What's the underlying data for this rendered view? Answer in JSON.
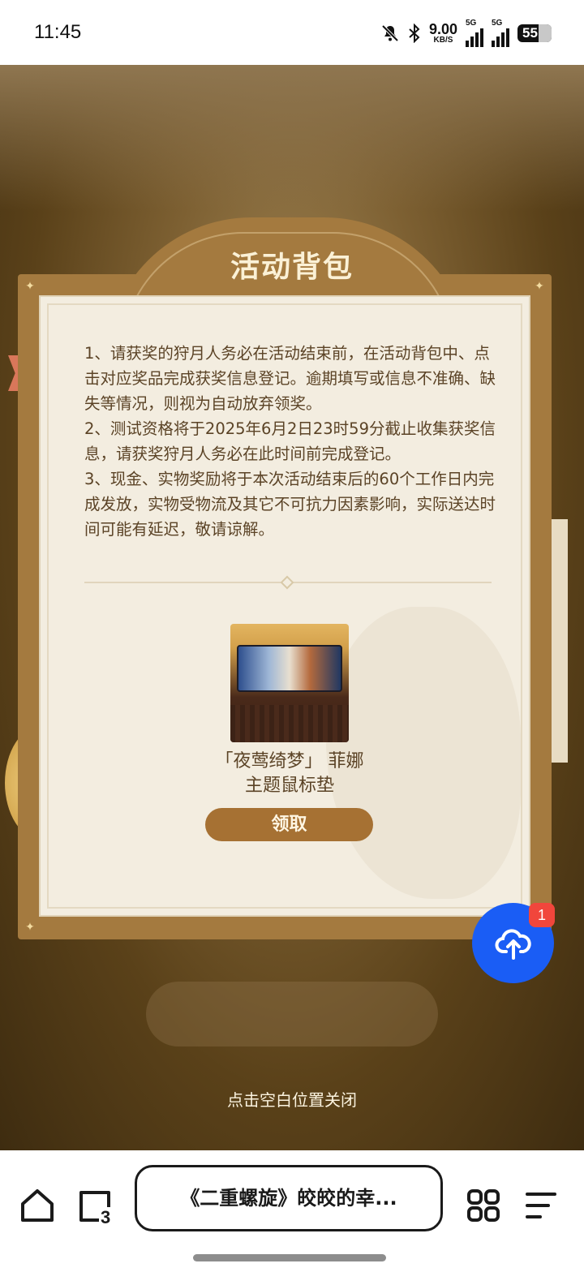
{
  "status_bar": {
    "time": "11:45",
    "net_speed_value": "9.00",
    "net_speed_unit": "KB/S",
    "signal1_label": "5G",
    "signal2_label": "5G",
    "battery": "55",
    "icons": [
      "mute-bell-icon",
      "bluetooth-icon",
      "signal-icon",
      "battery-icon"
    ]
  },
  "modal": {
    "title": "活动背包",
    "rules": [
      "1、请获奖的狩月人务必在活动结束前，在活动背包中、点击对应奖品完成获奖信息登记。逾期填写或信息不准确、缺失等情况，则视为自动放弃领奖。",
      "2、测试资格将于2025年6月2日23时59分截止收集获奖信息，请获奖狩月人务必在此时间前完成登记。",
      "3、现金、实物奖励将于本次活动结束后的60个工作日内完成发放，实物受物流及其它不可抗力因素影响，实际送达时间可能有延迟，敬请谅解。"
    ],
    "prize": {
      "name_line1": "「夜莺绮梦」 菲娜",
      "name_line2": "主题鼠标垫",
      "claim_label": "领取"
    }
  },
  "close_hint": "点击空白位置关闭",
  "fab": {
    "badge": "1",
    "icon": "cloud-upload-icon",
    "color": "#1a5df5"
  },
  "bottom_nav": {
    "tab_count": "3",
    "tab_title": "《二重螺旋》皎皎的幸...",
    "icons": [
      "home-icon",
      "tabs-icon",
      "apps-grid-icon",
      "menu-icon"
    ]
  },
  "colors": {
    "frame": "#a47a3f",
    "paper": "#f3ede0",
    "text": "#5b4326",
    "claim_button": "#a67133"
  }
}
